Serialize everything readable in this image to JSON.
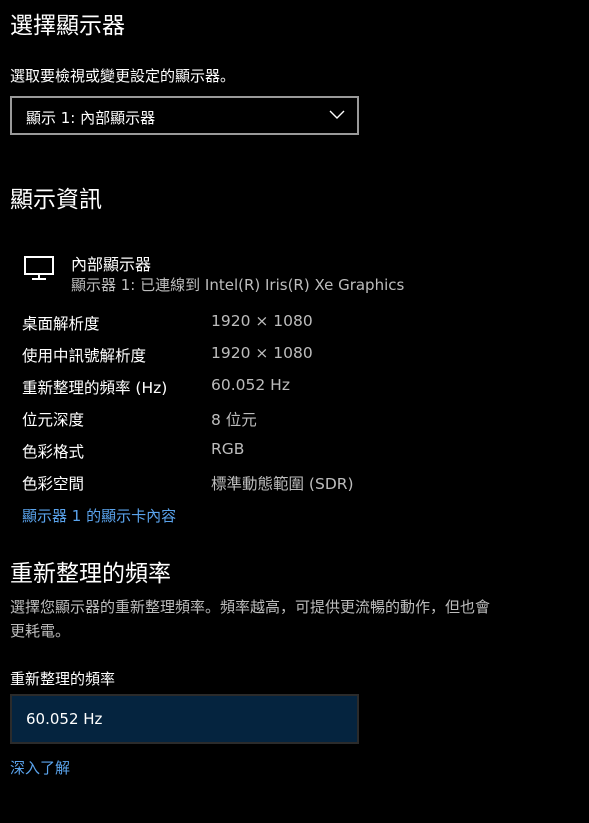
{
  "select_display": {
    "title": "選擇顯示器",
    "instruction": "選取要檢視或變更設定的顯示器。",
    "dropdown_value": "顯示 1: 內部顯示器"
  },
  "display_info": {
    "title": "顯示資訊",
    "monitor_icon": "monitor-icon",
    "monitor_name": "內部顯示器",
    "monitor_subtitle": "顯示器 1: 已連線到 Intel(R) Iris(R) Xe Graphics",
    "rows": [
      {
        "label": "桌面解析度",
        "value": "1920 × 1080"
      },
      {
        "label": "使用中訊號解析度",
        "value": "1920 × 1080"
      },
      {
        "label": "重新整理的頻率 (Hz)",
        "value": "60.052 Hz"
      },
      {
        "label": "位元深度",
        "value": "8 位元"
      },
      {
        "label": "色彩格式",
        "value": "RGB"
      },
      {
        "label": "色彩空間",
        "value": "標準動態範圍 (SDR)"
      }
    ],
    "adapter_link": "顯示器 1 的顯示卡內容"
  },
  "refresh_rate": {
    "title": "重新整理的頻率",
    "description_line1": "選擇您顯示器的重新整理頻率。頻率越高，可提供更流暢的動作，但也會",
    "description_line2": "更耗電。",
    "field_label": "重新整理的頻率",
    "selected_value": "60.052 Hz",
    "learn_more_link": "深入了解"
  },
  "colors": {
    "background": "#000000",
    "link": "#5aa3ec",
    "muted_text": "#bdbdbd",
    "selected_box": "#05243f"
  }
}
